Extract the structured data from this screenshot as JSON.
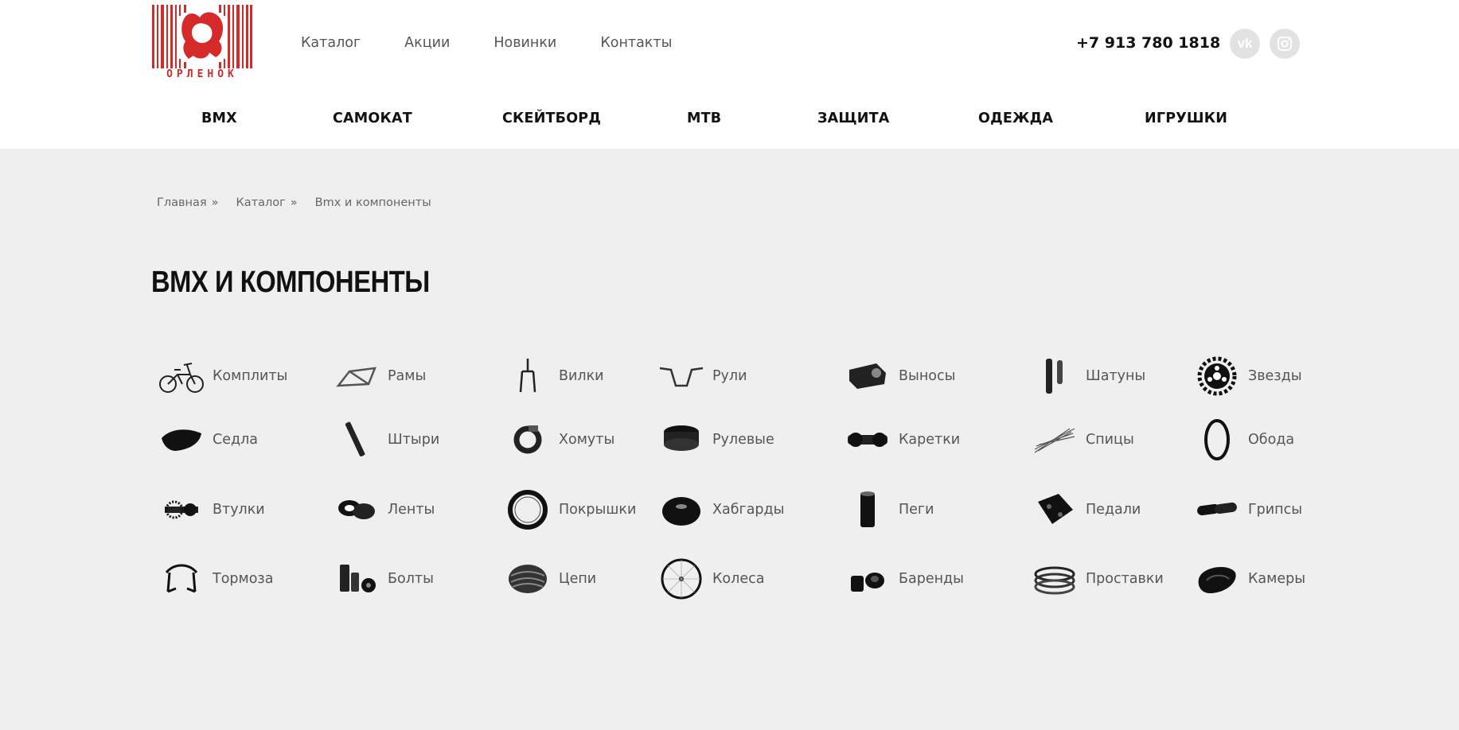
{
  "logo": {
    "text": "ОРЛЕНОК"
  },
  "top_nav": [
    "Каталог",
    "Акции",
    "Новинки",
    "Контакты"
  ],
  "phone": "+7 913 780 1818",
  "social": [
    {
      "icon": "vk-icon",
      "label": "vk"
    },
    {
      "icon": "instagram-icon",
      "label": ""
    }
  ],
  "category_nav": [
    "BMX",
    "САМОКАТ",
    "СКЕЙТБОРД",
    "MTB",
    "ЗАЩИТА",
    "ОДЕЖДА",
    "ИГРУШКИ"
  ],
  "breadcrumb": {
    "items": [
      "Главная",
      "Каталог",
      "Bmx и компоненты"
    ],
    "separator": "»"
  },
  "page_title": "BMX И КОМПОНЕНТЫ",
  "products": [
    {
      "label": "Комплиты",
      "icon": "bike-icon"
    },
    {
      "label": "Рамы",
      "icon": "frame-icon"
    },
    {
      "label": "Вилки",
      "icon": "fork-icon"
    },
    {
      "label": "Рули",
      "icon": "handlebar-icon"
    },
    {
      "label": "Выносы",
      "icon": "stem-icon"
    },
    {
      "label": "Шатуны",
      "icon": "crank-icon"
    },
    {
      "label": "Звезды",
      "icon": "sprocket-icon"
    },
    {
      "label": "Седла",
      "icon": "saddle-icon"
    },
    {
      "label": "Штыри",
      "icon": "seatpost-icon"
    },
    {
      "label": "Хомуты",
      "icon": "clamp-icon"
    },
    {
      "label": "Рулевые",
      "icon": "headset-icon"
    },
    {
      "label": "Каретки",
      "icon": "bottom-bracket-icon"
    },
    {
      "label": "Спицы",
      "icon": "spokes-icon"
    },
    {
      "label": "Обода",
      "icon": "rim-icon"
    },
    {
      "label": "Втулки",
      "icon": "hub-icon"
    },
    {
      "label": "Ленты",
      "icon": "rim-tape-icon"
    },
    {
      "label": "Покрышки",
      "icon": "tire-icon"
    },
    {
      "label": "Хабгарды",
      "icon": "hubguard-icon"
    },
    {
      "label": "Пеги",
      "icon": "peg-icon"
    },
    {
      "label": "Педали",
      "icon": "pedal-icon"
    },
    {
      "label": "Грипсы",
      "icon": "grips-icon"
    },
    {
      "label": "Тормоза",
      "icon": "brake-icon"
    },
    {
      "label": "Болты",
      "icon": "bolts-icon"
    },
    {
      "label": "Цепи",
      "icon": "chain-icon"
    },
    {
      "label": "Колеса",
      "icon": "wheel-icon"
    },
    {
      "label": "Баренды",
      "icon": "bar-ends-icon"
    },
    {
      "label": "Проставки",
      "icon": "spacers-icon"
    },
    {
      "label": "Камеры",
      "icon": "tube-icon"
    }
  ],
  "colors": {
    "logo_red": "#d42a2a",
    "header_bg": "#ffffff",
    "page_bg": "#efefef",
    "social_bg": "#e2e2e2"
  }
}
